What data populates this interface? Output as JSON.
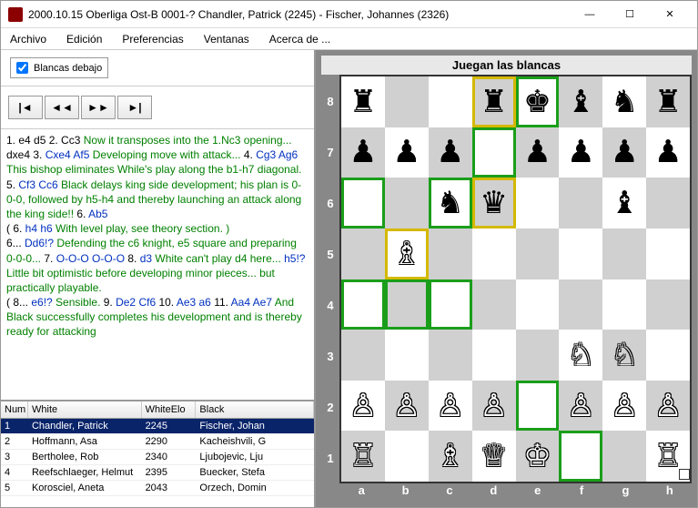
{
  "titlebar": {
    "text": "2000.10.15 Oberliga Ost-B 0001-? Chandler, Patrick (2245) - Fischer, Johannes (2326)"
  },
  "win": {
    "min": "—",
    "max": "☐",
    "close": "✕"
  },
  "menus": [
    "Archivo",
    "Edición",
    "Preferencias",
    "Ventanas",
    "Acerca de ..."
  ],
  "options": {
    "whites_below_label": "Blancas debajo"
  },
  "nav": {
    "first": "|◄",
    "back": "◄◄",
    "fwd": "►►",
    "last": "►|"
  },
  "moves_segments": [
    {
      "t": "1. e4 d5",
      "c": "m-black"
    },
    {
      "t": " 2. Cc3",
      "c": "m-black"
    },
    {
      "t": " Now it transposes into the 1.Nc3 opening...",
      "c": "m-green"
    },
    {
      "t": " dxe4",
      "c": "m-black"
    },
    {
      "t": " 3. ",
      "c": "m-black"
    },
    {
      "t": "Cxe4 Af5",
      "c": "m-blue"
    },
    {
      "t": " Developing move with attack...",
      "c": "m-green"
    },
    {
      "t": " 4. ",
      "c": "m-black"
    },
    {
      "t": "Cg3 Ag6",
      "c": "m-blue"
    },
    {
      "t": " This bishop eliminates While's play along the b1-h7 diagonal.",
      "c": "m-green"
    },
    {
      "t": " 5. ",
      "c": "m-black"
    },
    {
      "t": "Cf3 Cc6",
      "c": "m-blue"
    },
    {
      "t": " Black delays king side development; his plan is 0-0-0, followed by h5-h4 and thereby launching an attack along the king side!!",
      "c": "m-green"
    },
    {
      "t": " 6. ",
      "c": "m-black"
    },
    {
      "t": "Ab5",
      "c": "m-blue"
    },
    {
      "t": "\n",
      "c": ""
    },
    {
      "t": "    ( 6. ",
      "c": "m-black"
    },
    {
      "t": "h4 h6",
      "c": "m-blue"
    },
    {
      "t": " With level play, see theory section. )",
      "c": "m-green"
    },
    {
      "t": "\n",
      "c": ""
    },
    {
      "t": "6... ",
      "c": "m-black"
    },
    {
      "t": "Dd6!?",
      "c": "m-blue"
    },
    {
      "t": " Defending the c6 knight, e5 square and preparing 0-0-0...",
      "c": "m-green"
    },
    {
      "t": " 7. ",
      "c": "m-black"
    },
    {
      "t": "O-O-O O-O-O",
      "c": "m-blue"
    },
    {
      "t": " 8. ",
      "c": "m-black"
    },
    {
      "t": "d3",
      "c": "m-blue"
    },
    {
      "t": " White can't play d4 here...",
      "c": "m-green"
    },
    {
      "t": " h5!?",
      "c": "m-blue"
    },
    {
      "t": " Little bit optimistic before developing minor pieces... but practically playable.",
      "c": "m-green"
    },
    {
      "t": "\n",
      "c": ""
    },
    {
      "t": "    ( 8... ",
      "c": "m-black"
    },
    {
      "t": "e6!?",
      "c": "m-blue"
    },
    {
      "t": " Sensible.",
      "c": "m-green"
    },
    {
      "t": " 9. ",
      "c": "m-black"
    },
    {
      "t": "De2 Cf6",
      "c": "m-blue"
    },
    {
      "t": " 10. ",
      "c": "m-black"
    },
    {
      "t": "Ae3 a6",
      "c": "m-blue"
    },
    {
      "t": " 11. ",
      "c": "m-black"
    },
    {
      "t": "Aa4 Ae7",
      "c": "m-blue"
    },
    {
      "t": " And Black successfully completes his development and is thereby ready for attacking",
      "c": "m-green"
    }
  ],
  "grid": {
    "headers": {
      "num": "Num",
      "white": "White",
      "elo": "WhiteElo",
      "black": "Black"
    },
    "rows": [
      {
        "num": "1",
        "white": "Chandler, Patrick",
        "elo": "2245",
        "black": "Fischer, Johan",
        "sel": true
      },
      {
        "num": "2",
        "white": "Hoffmann, Asa",
        "elo": "2290",
        "black": "Kacheishvili, G"
      },
      {
        "num": "3",
        "white": "Bertholee, Rob",
        "elo": "2340",
        "black": "Ljubojevic, Lju"
      },
      {
        "num": "4",
        "white": "Reefschlaeger, Helmut",
        "elo": "2395",
        "black": "Buecker, Stefa"
      },
      {
        "num": "5",
        "white": "Korosciel, Aneta",
        "elo": "2043",
        "black": "Orzech, Domin"
      }
    ]
  },
  "board": {
    "title": "Juegan las blancas",
    "ranks": [
      "8",
      "7",
      "6",
      "5",
      "4",
      "3",
      "2",
      "1"
    ],
    "files": [
      "a",
      "b",
      "c",
      "d",
      "e",
      "f",
      "g",
      "h"
    ],
    "position": {
      "a8": "br",
      "d8": "br",
      "e8": "bk",
      "f8": "bb",
      "g8": "bn",
      "h8": "br",
      "a7": "bp",
      "b7": "bp",
      "c7": "bp",
      "e7": "bp",
      "f7": "bp",
      "g7": "bp",
      "h7": "bp",
      "c6": "bn",
      "d6": "bq",
      "g6": "bb",
      "b5": "wb",
      "f3": "wn",
      "g3": "wn",
      "a2": "wp",
      "b2": "wp",
      "c2": "wp",
      "d2": "wp",
      "f2": "wp",
      "g2": "wp",
      "h2": "wp",
      "a1": "wr",
      "c1": "wb",
      "d1": "wq",
      "e1": "wk",
      "h1": "wr"
    },
    "highlights_green": [
      "a4",
      "a6",
      "b4",
      "c4",
      "c6",
      "d7",
      "e2",
      "f1",
      "e8"
    ],
    "highlights_yellow": [
      "b5",
      "d6",
      "d8"
    ]
  }
}
